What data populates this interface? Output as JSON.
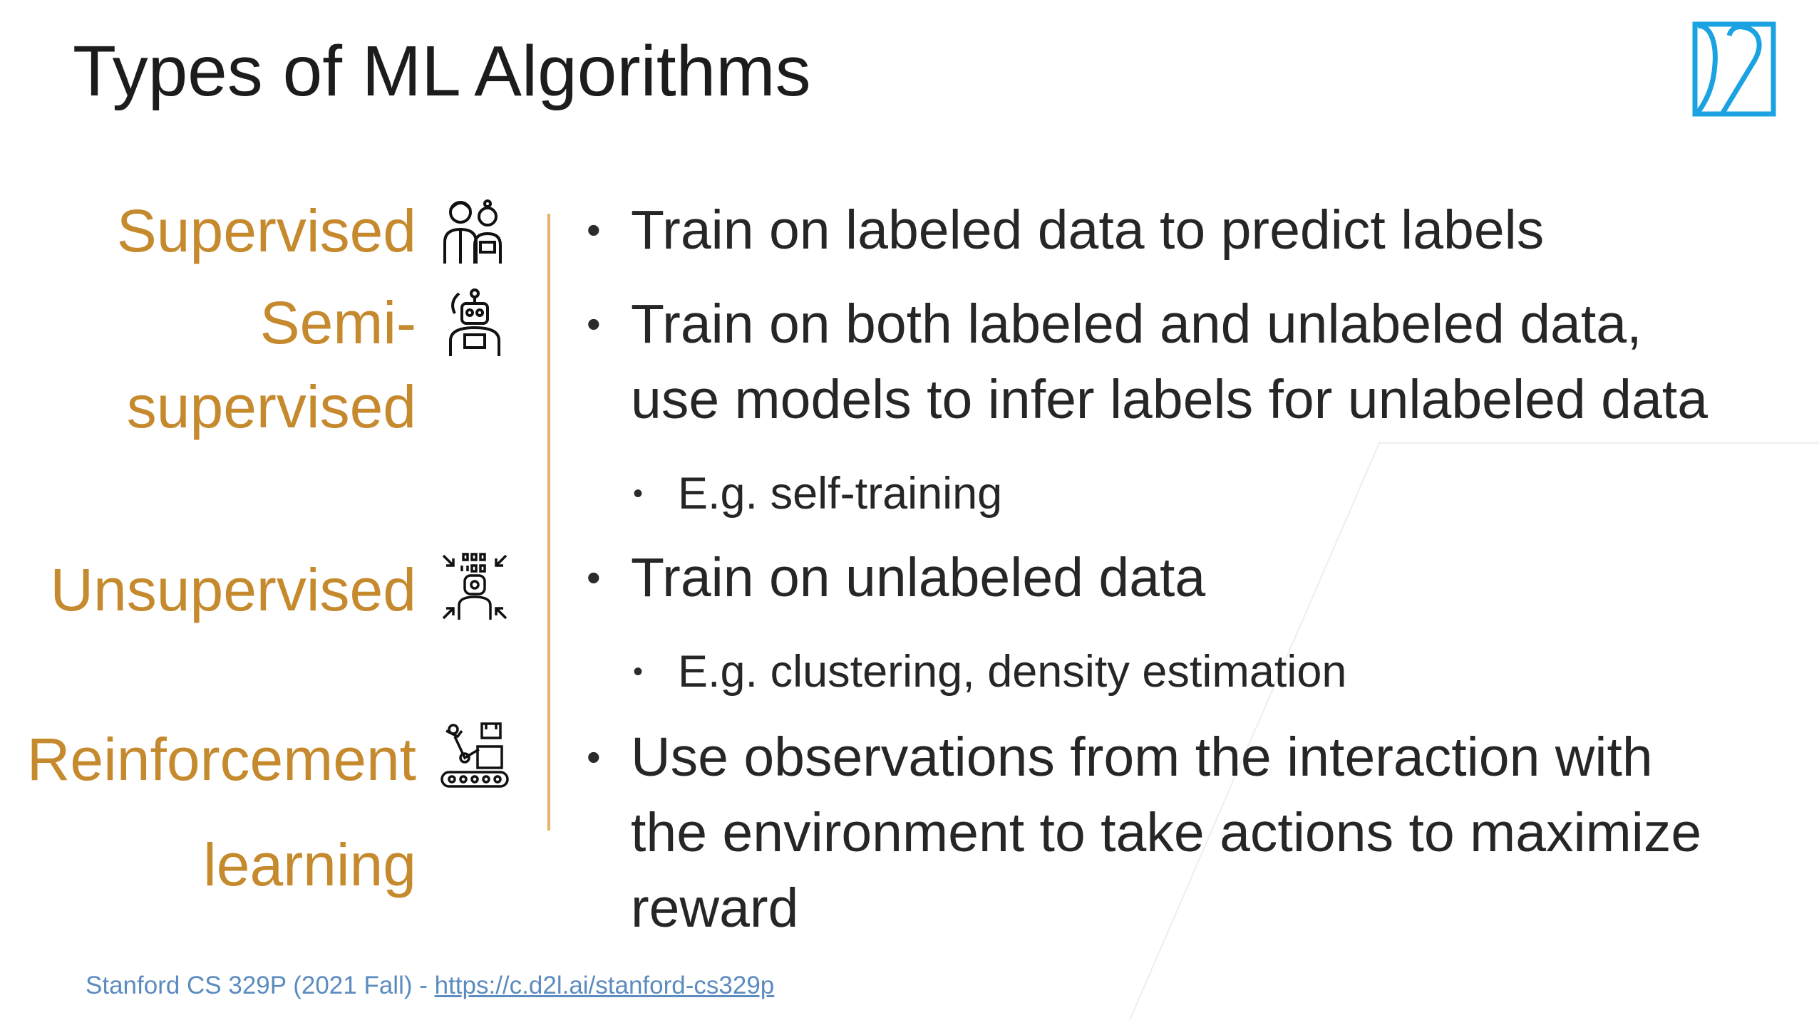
{
  "slide": {
    "title": "Types of ML Algorithms",
    "logo_icon": "d2l-logo-icon",
    "accent_color": "#c68a2e",
    "link_color": "#5b8bbf"
  },
  "categories": [
    {
      "label": "Supervised",
      "icon": "supervised-people-icon"
    },
    {
      "label": "Semi-\nsupervised",
      "icon": "semi-supervised-robot-icon"
    },
    {
      "label": "Unsupervised",
      "icon": "unsupervised-binary-robot-icon"
    },
    {
      "label": "Reinforcement\nlearning",
      "icon": "reinforcement-robot-arm-icon"
    }
  ],
  "bullets": [
    {
      "text": "Train on labeled data to predict labels"
    },
    {
      "text": "Train on both labeled and unlabeled data,\nuse models to infer labels for unlabeled data"
    },
    {
      "text": "E.g. self-training"
    },
    {
      "text": "Train on unlabeled data"
    },
    {
      "text": "E.g. clustering, density estimation"
    },
    {
      "text": "Use observations from the interaction with\nthe environment to take actions to maximize\nreward"
    }
  ],
  "bullet_symbol": "•",
  "footer": {
    "prefix": "Stanford CS 329P (2021 Fall) - ",
    "link_text": "https://c.d2l.ai/stanford-cs329p"
  }
}
